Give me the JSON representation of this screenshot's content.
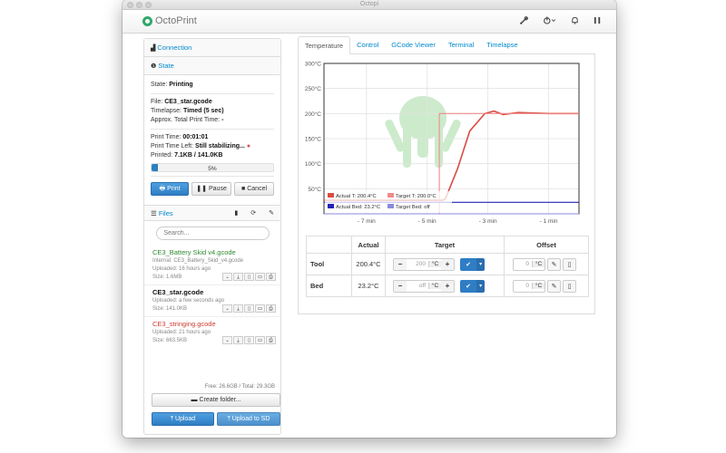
{
  "window": {
    "title": "Octopi"
  },
  "navbar": {
    "brand": "OctoPrint",
    "icons": [
      "wrench-icon",
      "power-icon",
      "bell-icon",
      "user-icon"
    ]
  },
  "sidebar": {
    "connection": {
      "label": "Connection"
    },
    "state": {
      "label": "State",
      "state_label": "State:",
      "state_value": "Printing",
      "file_label": "File:",
      "file_value": "CE3_star.gcode",
      "timelapse_label": "Timelapse:",
      "timelapse_value": "Timed (5 sec)",
      "approx_label": "Approx. Total Print Time:",
      "approx_value": "-",
      "print_time_label": "Print Time:",
      "print_time_value": "00:01:01",
      "time_left_label": "Print Time Left:",
      "time_left_value": "Still stabilizing...",
      "printed_label": "Printed:",
      "printed_value": "7.1KB / 141.0KB",
      "progress": 5,
      "progress_text": "5%"
    },
    "buttons": {
      "print": "Print",
      "pause": "Pause",
      "cancel": "Cancel"
    },
    "files": {
      "label": "Files",
      "search_placeholder": "Search...",
      "items": [
        {
          "name": "CE3_Battery Skid v4.gcode",
          "internal": "Internal: CE3_Battery_Skid_v4.gcode",
          "uploaded": "Uploaded: 16 hours ago",
          "size": "Size: 1.6MB"
        },
        {
          "name": "CE3_star.gcode",
          "uploaded": "Uploaded: a few seconds ago",
          "size": "Size: 141.0KB"
        },
        {
          "name": "CE3_stringing.gcode",
          "uploaded": "Uploaded: 21 hours ago",
          "size": "Size: 663.5KB"
        }
      ],
      "free": "Free: 26.6GB / Total: 29.3GB",
      "create_folder": "Create folder...",
      "upload": "Upload",
      "upload_sd": "Upload to SD"
    }
  },
  "tabs": [
    "Temperature",
    "Control",
    "GCode Viewer",
    "Terminal",
    "Timelapse"
  ],
  "chart_data": {
    "type": "line",
    "y_ticks": [
      "300°C",
      "250°C",
      "200°C",
      "150°C",
      "100°C",
      "50°C"
    ],
    "x_ticks": [
      "- 7 min",
      "- 5 min",
      "- 3 min",
      "- 1 min"
    ],
    "ylim": [
      0,
      300
    ],
    "legend": [
      "Actual T: 200.4°C",
      "Target T: 200.0°C",
      "Actual Bed: 23.2°C",
      "Target Bed: off"
    ],
    "series": [
      {
        "name": "Actual T",
        "x": [
          -8.4,
          -4.5,
          -4.4,
          -4.0,
          -3.6,
          -3.1,
          -2.8,
          -2.5,
          -2.0,
          -1.0,
          0.0
        ],
        "values": [
          27,
          27,
          30,
          90,
          165,
          200,
          205,
          198,
          202,
          200,
          200
        ],
        "color": "#d94d42"
      },
      {
        "name": "Target T",
        "x": [
          -8.4,
          -4.6,
          -4.6,
          0.0
        ],
        "values": [
          0,
          0,
          200,
          200
        ],
        "color": "#f08a8a"
      },
      {
        "name": "Actual Bed",
        "x": [
          -8.4,
          0.0
        ],
        "values": [
          23,
          23
        ],
        "color": "#2222b8"
      },
      {
        "name": "Target Bed",
        "x": [
          -8.4,
          0.0
        ],
        "values": [
          0,
          0
        ],
        "color": "#8a8ae0"
      }
    ]
  },
  "temp_table": {
    "headers": [
      "",
      "Actual",
      "Target",
      "Offset"
    ],
    "rows": [
      {
        "name": "Tool",
        "actual": "200.4°C",
        "target": "200",
        "unit": "°C",
        "offset": "0",
        "offset_unit": "°C"
      },
      {
        "name": "Bed",
        "actual": "23.2°C",
        "target": "off",
        "unit": "°C",
        "offset": "0",
        "offset_unit": "°C"
      }
    ]
  }
}
